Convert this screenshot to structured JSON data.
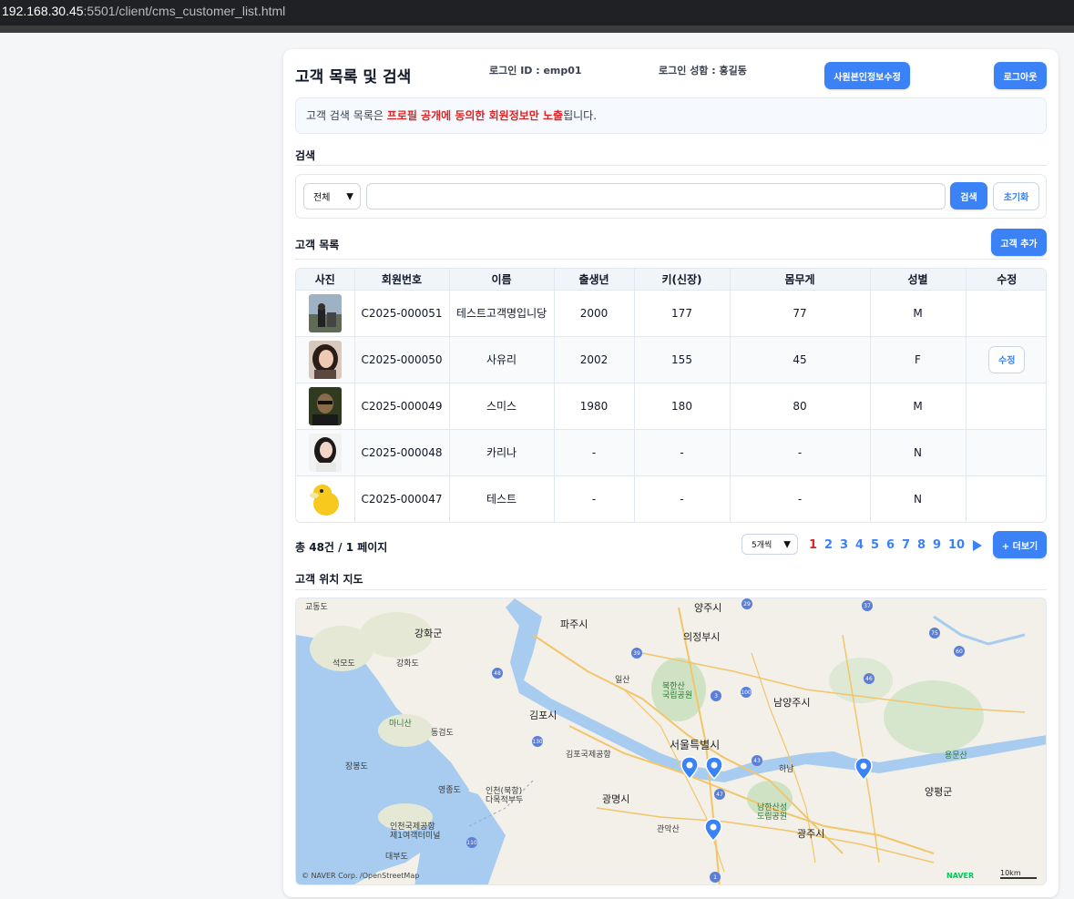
{
  "browser": {
    "host": "192.168.30.45",
    "path": ":5501/client/cms_customer_list.html"
  },
  "header": {
    "title": "고객 목록 및 검색",
    "login_id": "로그인 ID : emp01",
    "login_name": "로그인 성함 : 홍길동",
    "edit_profile_label": "사원본인정보수정",
    "logout_label": "로그아웃"
  },
  "notice": {
    "prefix": "고객 검색 목록은 ",
    "highlight": "프로필 공개에 동의한 회원정보만 노출",
    "suffix": "됩니다."
  },
  "search": {
    "section_title": "검색",
    "scope_value": "전체",
    "query_value": "",
    "search_label": "검색",
    "reset_label": "초기화"
  },
  "list": {
    "section_title": "고객 목록",
    "add_label": "고객 추가",
    "columns": [
      "사진",
      "회원번호",
      "이름",
      "출생년",
      "키(신장)",
      "몸무게",
      "성별",
      "수정"
    ],
    "rows": [
      {
        "id": "C2025-000051",
        "name": "테스트고객명입니당",
        "birth": "2000",
        "height": "177",
        "weight": "77",
        "gender": "M",
        "edit": ""
      },
      {
        "id": "C2025-000050",
        "name": "사유리",
        "birth": "2002",
        "height": "155",
        "weight": "45",
        "gender": "F",
        "edit": "수정"
      },
      {
        "id": "C2025-000049",
        "name": "스미스",
        "birth": "1980",
        "height": "180",
        "weight": "80",
        "gender": "M",
        "edit": ""
      },
      {
        "id": "C2025-000048",
        "name": "카리나",
        "birth": "-",
        "height": "-",
        "weight": "-",
        "gender": "N",
        "edit": ""
      },
      {
        "id": "C2025-000047",
        "name": "테스트",
        "birth": "-",
        "height": "-",
        "weight": "-",
        "gender": "N",
        "edit": ""
      }
    ]
  },
  "pagination": {
    "total_text": "총 48건 / 1 페이지",
    "page_size_value": "5개씩",
    "pages": [
      "1",
      "2",
      "3",
      "4",
      "5",
      "6",
      "7",
      "8",
      "9",
      "10"
    ],
    "current_page": "1",
    "more_label": "+ 더보기"
  },
  "map": {
    "section_title": "고객 위치 지도",
    "attribution": "© NAVER Corp. /OpenStreetMap",
    "brand": "NAVER",
    "scale": "10km",
    "labels": {
      "seoul": "서울특별시",
      "gimpo": "김포시",
      "gwangmyeong": "광명시",
      "gwangju": "광주시",
      "namyangju": "남양주시",
      "uijeongbu": "의정부시",
      "yangju": "양주시",
      "paju": "파주시",
      "ganghwa": "강화군",
      "yangpyeong": "양평군",
      "hanam": "하남",
      "gyodongdo": "교동도",
      "gangwhado": "강화도",
      "seongmodo": "석모도",
      "maisan": "마니산",
      "yeongjongdo": "영종도",
      "jangbongdo": "장봉도",
      "incheon_airport": "인천국제공항\n제1여객터미널",
      "dongi": "동검도",
      "sinmaeul": "인천(북항)\n다목적부두",
      "gimpo_airport": "김포국제공항",
      "bukhansan": "북한산\n국립공원",
      "namhansan": "남한산성\n도립공원",
      "ilsan": "일산",
      "gwanak": "관악산",
      "daebudo": "대부도",
      "yongmunsan": "용문산"
    },
    "route_badges": [
      "29",
      "37",
      "75",
      "60",
      "39",
      "48",
      "3",
      "100",
      "46",
      "130",
      "43",
      "47",
      "110",
      "1"
    ]
  }
}
